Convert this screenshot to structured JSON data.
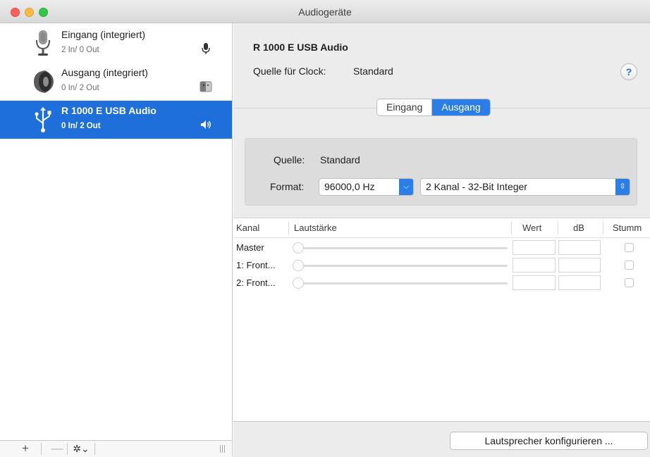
{
  "window": {
    "title": "Audiogeräte"
  },
  "devices": [
    {
      "name": "Eingang (integriert)",
      "io": "2 In/ 0 Out",
      "icon": "microphone-icon",
      "badge": "microphone-badge-icon",
      "selected": false
    },
    {
      "name": "Ausgang (integriert)",
      "io": "0 In/ 2 Out",
      "icon": "speaker-icon",
      "badge": "finder-badge-icon",
      "selected": false
    },
    {
      "name": "R 1000 E  USB Audio",
      "io": "0 In/ 2 Out",
      "icon": "usb-icon",
      "badge": "volume-badge-icon",
      "selected": true
    }
  ],
  "sidebar_toolbar": {
    "add": "+",
    "remove": "—",
    "gear": "✲⌄"
  },
  "detail": {
    "device_title": "R 1000 E  USB Audio",
    "clock_label": "Quelle für Clock:",
    "clock_value": "Standard",
    "help": "?",
    "tabs": [
      {
        "label": "Eingang",
        "active": false
      },
      {
        "label": "Ausgang",
        "active": true
      }
    ],
    "source_label": "Quelle:",
    "source_value": "Standard",
    "format_label": "Format:",
    "sample_rate": "96000,0 Hz",
    "format_value": "2 Kanal - 32-Bit Integer",
    "table": {
      "headers": {
        "kanal": "Kanal",
        "lautstaerke": "Lautstärke",
        "wert": "Wert",
        "db": "dB",
        "stumm": "Stumm"
      },
      "rows": [
        {
          "kanal": "Master",
          "volume": 0,
          "wert": "",
          "db": "",
          "mute": false
        },
        {
          "kanal": "1: Front...",
          "volume": 0,
          "wert": "",
          "db": "",
          "mute": false
        },
        {
          "kanal": "2: Front...",
          "volume": 0,
          "wert": "",
          "db": "",
          "mute": false
        }
      ]
    },
    "configure_button": "Lautsprecher konfigurieren ..."
  },
  "colors": {
    "accent": "#1e6fd9",
    "segment_active": "#2b7ee5",
    "window_bg": "#ececec"
  }
}
